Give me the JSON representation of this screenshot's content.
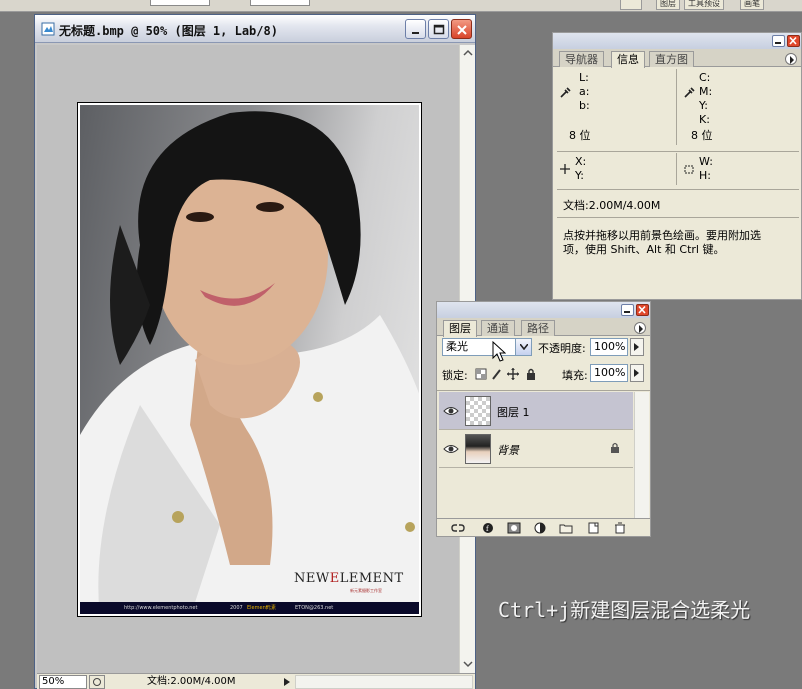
{
  "app": {
    "top_tabs": [
      "图层",
      "工具预设",
      "画笔"
    ]
  },
  "document": {
    "title": "无标题.bmp @ 50% (图层 1, Lab/8)",
    "zoom": "50%",
    "doc_size": "文档:2.00M/4.00M",
    "photo": {
      "brand_prefix": "NEW",
      "brand_accent": "E",
      "brand_rest": "LEMENT",
      "brand_sub": "新元素摄影工作室",
      "url": "http://www.elementphoto.net",
      "year": "2007",
      "element_label": "Element",
      "element_cn": "元素",
      "email": "ETON@263.net"
    }
  },
  "panels": {
    "info": {
      "tabs": [
        "导航器",
        "信息",
        "直方图"
      ],
      "active_tab": "信息",
      "lab_labels": [
        "L:",
        "a:",
        "b:"
      ],
      "cmyk_labels": [
        "C:",
        "M:",
        "Y:",
        "K:"
      ],
      "bit_depth_left": "8 位",
      "bit_depth_right": "8 位",
      "x_label": "X:",
      "y_label": "Y:",
      "w_label": "W:",
      "h_label": "H:",
      "doc_size": "文档:2.00M/4.00M",
      "hint_line1": "点按并拖移以用前景色绘画。要用附加选",
      "hint_line2": "项，使用 Shift、Alt 和 Ctrl 键。"
    },
    "layers": {
      "tabs": [
        "图层",
        "通道",
        "路径"
      ],
      "active_tab": "图层",
      "blend_mode": "柔光",
      "opacity_label": "不透明度:",
      "opacity_value": "100%",
      "lock_label": "锁定:",
      "fill_label": "填充:",
      "fill_value": "100%",
      "layers": [
        {
          "name": "图层 1",
          "selected": true
        },
        {
          "name": "背景",
          "selected": false
        }
      ]
    }
  },
  "caption": "Ctrl+j新建图层混合选柔光",
  "colors": {
    "workspace": "#7a7a7a",
    "panel_bg": "#ece9d8",
    "selected_layer": "#c5c4d1",
    "close_red": "#d9442a",
    "brand_accent": "#b01c1c"
  }
}
